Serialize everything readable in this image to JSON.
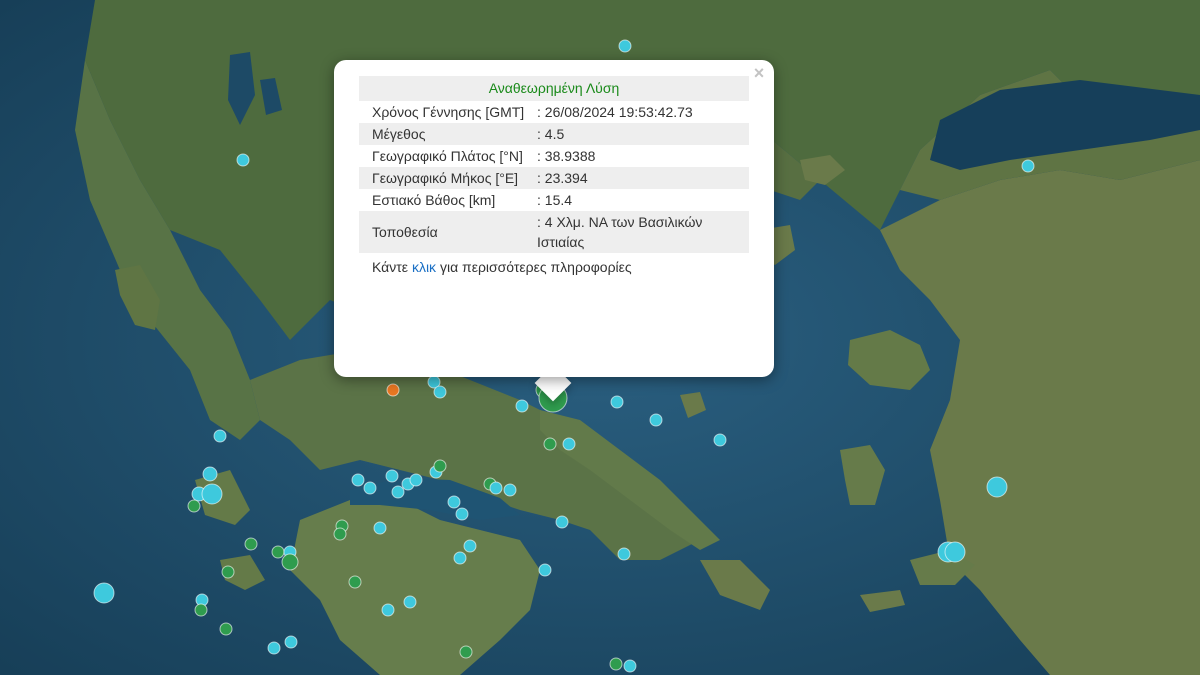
{
  "popup": {
    "title": "Αναθεωρημένη Λύση",
    "close_glyph": "×",
    "rows": [
      {
        "label": "Χρόνος Γέννησης [GMT]",
        "value": ": 26/08/2024 19:53:42.73"
      },
      {
        "label": "Μέγεθος",
        "value": ": 4.5"
      },
      {
        "label": "Γεωγραφικό Πλάτος [°N]",
        "value": ": 38.9388"
      },
      {
        "label": "Γεωγραφικό Μήκος [°E]",
        "value": ": 23.394"
      },
      {
        "label": "Εστιακό Βάθος [km]",
        "value": ": 15.4"
      },
      {
        "label": "Τοποθεσία",
        "value": ": 4 Χλμ. ΝΑ των Βασιλικών Ιστιαίας"
      }
    ],
    "more_prefix": "Κάντε",
    "more_link": "κλικ",
    "more_suffix": "για περισσότερες πληροφορίες"
  },
  "colors": {
    "sea": "#1f4e6b",
    "land": "#4a6a3c",
    "marker_cyan": "#3ec9dd",
    "marker_green": "#2f9c4e",
    "marker_orange": "#e87722",
    "marker_selected": "#2f9c4e"
  },
  "icons": {
    "close": "close-icon",
    "marker": "earthquake-marker-icon"
  }
}
